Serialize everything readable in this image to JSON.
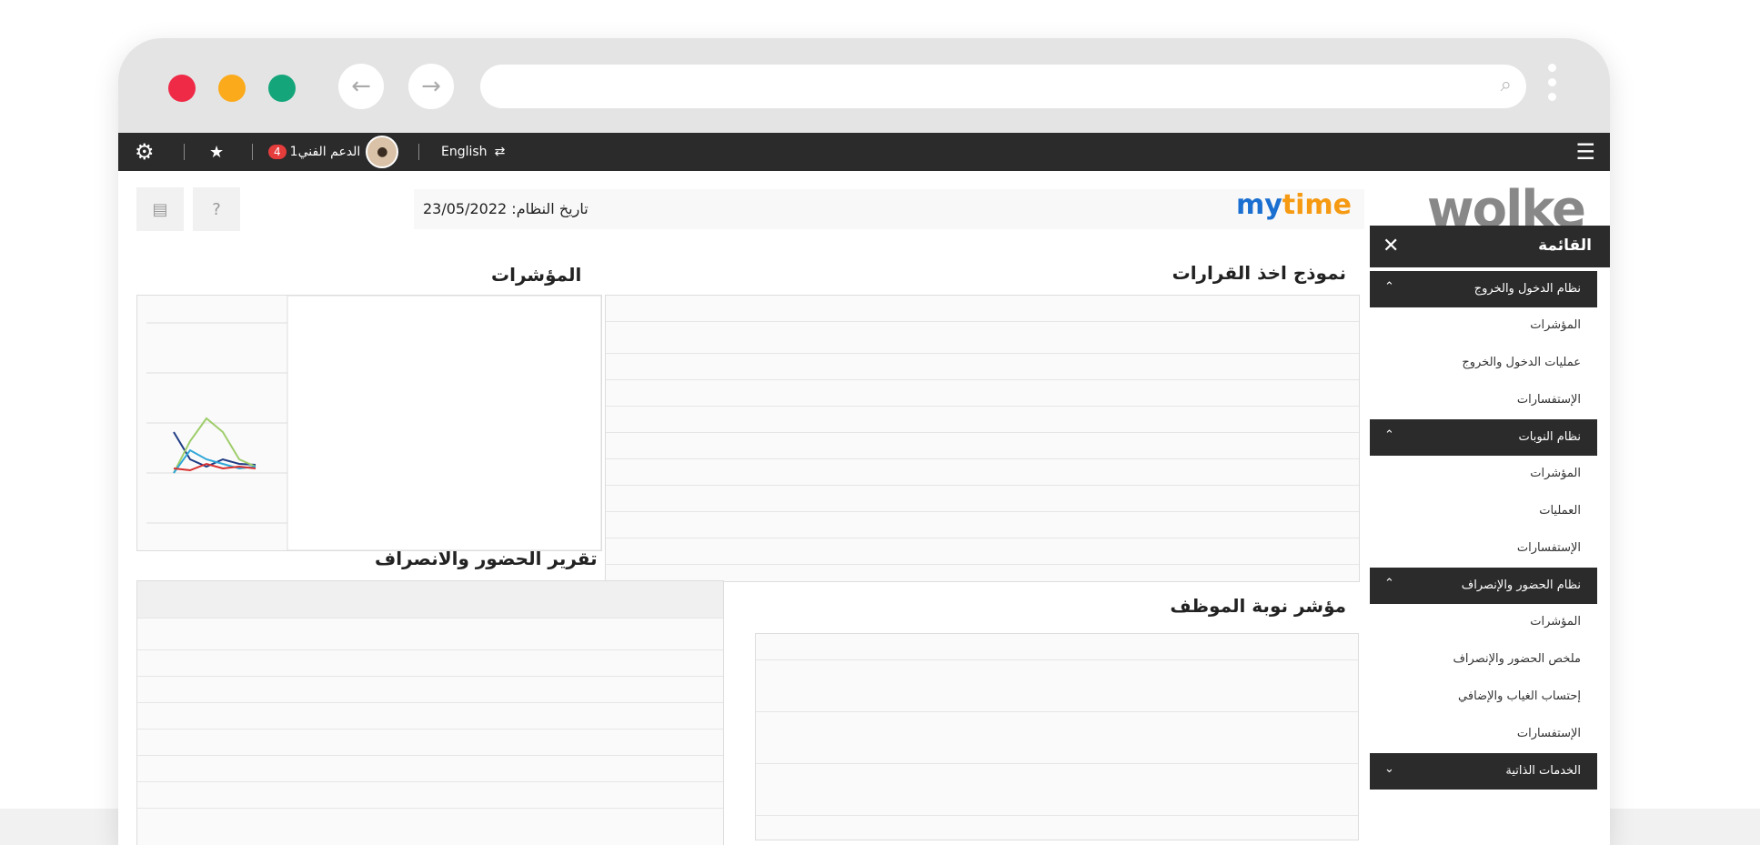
{
  "window": {
    "controls": [
      "close",
      "minimize",
      "maximize"
    ],
    "address_placeholder": "",
    "search_icon": "search-icon"
  },
  "topbar": {
    "language": "English",
    "support_label": "الدعم الفني1",
    "support_count": "4",
    "icons": {
      "settings": "gear-icon",
      "favorite": "star-icon",
      "menu": "hamburger-icon"
    }
  },
  "brand": {
    "logo": "wolke",
    "product": "mytime",
    "product_my": "my",
    "product_time": "time"
  },
  "system_date": "تاريخ النظام: 23/05/2022",
  "sections": {
    "decisions": "نموذج اخذ القرارات",
    "indicators": "المؤشرات",
    "attendance_report": "تقرير الحضور والانصراف",
    "shift_indicator": "مؤشر نوبة الموظف"
  },
  "menu": {
    "title": "القائمة",
    "items": [
      {
        "label": "نظام الدخول والخروج",
        "expanded": true,
        "children": [
          "المؤشرات",
          "عمليات الدخول والخروج",
          "الإستفسارات"
        ]
      },
      {
        "label": "نظام النوبات",
        "expanded": true,
        "children": [
          "المؤشرات",
          "العمليات",
          "الإستفسارات"
        ]
      },
      {
        "label": "نظام الحضور والإنصراف",
        "expanded": true,
        "children": [
          "المؤشرات",
          "ملخص الحضور والإنصراف",
          "إحتساب الغياب والإضافي",
          "الإستفسارات"
        ]
      },
      {
        "label": "الخدمات الذاتية",
        "expanded": false,
        "children": []
      }
    ]
  }
}
